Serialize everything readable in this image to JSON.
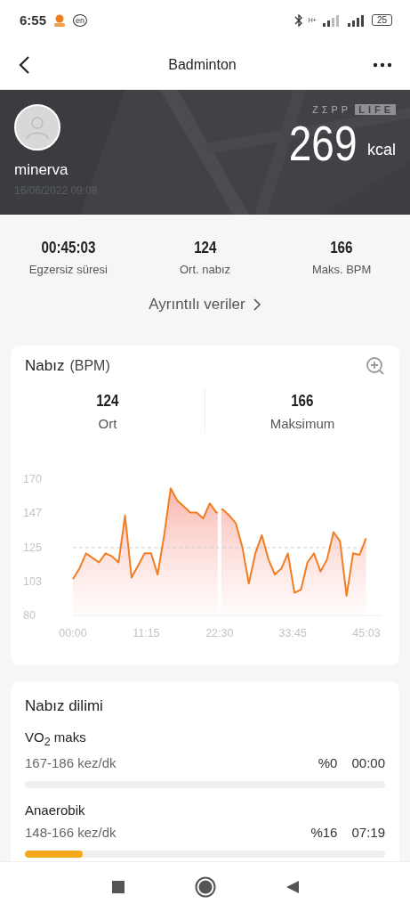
{
  "status_bar": {
    "time": "6:55",
    "language": "en",
    "network": "H+",
    "battery": "25"
  },
  "header": {
    "title": "Badminton"
  },
  "summary": {
    "user": "minerva",
    "date": "16/06/2022 09:08",
    "logo": [
      "ZΣPP",
      "LIFE"
    ],
    "calories": "269",
    "unit": "kcal"
  },
  "stats": [
    {
      "value": "00:45:03",
      "label": "Egzersiz süresi"
    },
    {
      "value": "124",
      "label": "Ort. nabız"
    },
    {
      "value": "166",
      "label": "Maks. BPM"
    }
  ],
  "details_link": "Ayrıntılı veriler",
  "heart_rate": {
    "title": "Nabız",
    "unit": "(BPM)",
    "summary": [
      {
        "value": "124",
        "label": "Ort"
      },
      {
        "value": "166",
        "label": "Maksimum"
      }
    ],
    "chart_data": {
      "type": "area",
      "x": [
        0,
        1,
        2,
        3,
        4,
        5,
        6,
        7,
        8,
        9,
        10,
        11,
        12,
        13,
        14,
        15,
        16,
        17,
        18,
        19,
        20,
        21,
        22,
        22.5,
        23,
        24,
        25,
        26,
        27,
        28,
        29,
        30,
        31,
        32,
        33,
        34,
        35,
        36,
        37,
        38,
        39,
        40,
        41,
        42,
        43,
        44,
        45
      ],
      "series": [
        {
          "color": "#f27d20",
          "values": [
            104,
            111,
            121,
            118,
            115,
            121,
            119,
            115,
            146,
            105,
            113,
            121,
            121,
            107,
            133,
            164,
            156,
            152,
            148,
            148,
            144,
            154,
            148,
            null,
            150,
            146,
            141,
            125,
            101,
            121,
            133,
            117,
            107,
            111,
            121,
            95,
            97,
            115,
            121,
            109,
            117,
            135,
            129,
            93,
            121,
            120,
            131
          ]
        }
      ],
      "xlim": [
        0,
        45.05
      ],
      "ylim": [
        80,
        170
      ],
      "xticks": [
        {
          "value": 0,
          "label": "00:00"
        },
        {
          "value": 11.25,
          "label": "11:15"
        },
        {
          "value": 22.5,
          "label": "22:30"
        },
        {
          "value": 33.75,
          "label": "33:45"
        },
        {
          "value": 45.05,
          "label": "45:03"
        }
      ],
      "yticks": [
        80,
        {
          "value": 102.5,
          "label": "103"
        },
        125,
        {
          "value": 147.5,
          "label": "147"
        },
        170
      ]
    }
  },
  "zones": {
    "title": "Nabız dilimi",
    "items": [
      {
        "name": "VO$_{2}$ maks",
        "range": "167-186 kez/dk",
        "percent": "%0",
        "time": "00:00"
      },
      {
        "name": "Anaerobik",
        "range": "148-166 kez/dk",
        "percent": "%16",
        "time": "07:19",
        "level": 0.16
      }
    ]
  }
}
